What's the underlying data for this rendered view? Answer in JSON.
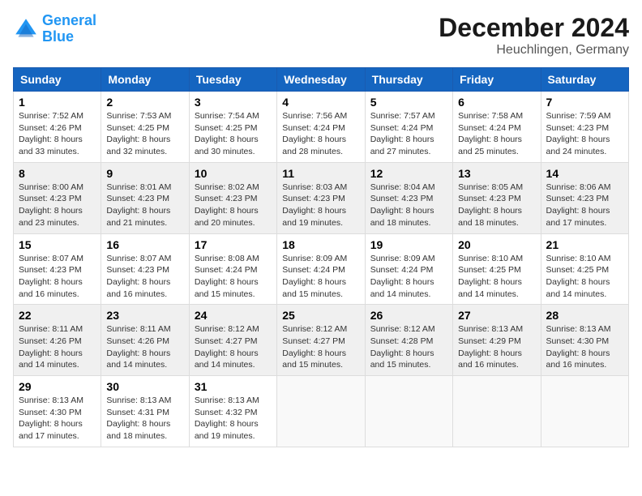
{
  "header": {
    "logo_line1": "General",
    "logo_line2": "Blue",
    "title": "December 2024",
    "subtitle": "Heuchlingen, Germany"
  },
  "calendar": {
    "days_of_week": [
      "Sunday",
      "Monday",
      "Tuesday",
      "Wednesday",
      "Thursday",
      "Friday",
      "Saturday"
    ],
    "weeks": [
      [
        null,
        null,
        null,
        null,
        null,
        null,
        null
      ]
    ],
    "cells": [
      {
        "day": null,
        "info": null
      },
      {
        "day": null,
        "info": null
      },
      {
        "day": null,
        "info": null
      },
      {
        "day": null,
        "info": null
      },
      {
        "day": null,
        "info": null
      },
      {
        "day": null,
        "info": null
      },
      {
        "day": null,
        "info": null
      }
    ],
    "rows": [
      [
        {
          "day": "",
          "info": ""
        },
        {
          "day": "",
          "info": ""
        },
        {
          "day": "",
          "info": ""
        },
        {
          "day": "",
          "info": ""
        },
        {
          "day": "",
          "info": ""
        },
        {
          "day": "",
          "info": ""
        },
        {
          "day": "",
          "info": ""
        }
      ]
    ]
  },
  "days": [
    {
      "num": "1",
      "sunrise": "Sunrise: 7:52 AM",
      "sunset": "Sunset: 4:26 PM",
      "daylight": "Daylight: 8 hours and 33 minutes."
    },
    {
      "num": "2",
      "sunrise": "Sunrise: 7:53 AM",
      "sunset": "Sunset: 4:25 PM",
      "daylight": "Daylight: 8 hours and 32 minutes."
    },
    {
      "num": "3",
      "sunrise": "Sunrise: 7:54 AM",
      "sunset": "Sunset: 4:25 PM",
      "daylight": "Daylight: 8 hours and 30 minutes."
    },
    {
      "num": "4",
      "sunrise": "Sunrise: 7:56 AM",
      "sunset": "Sunset: 4:24 PM",
      "daylight": "Daylight: 8 hours and 28 minutes."
    },
    {
      "num": "5",
      "sunrise": "Sunrise: 7:57 AM",
      "sunset": "Sunset: 4:24 PM",
      "daylight": "Daylight: 8 hours and 27 minutes."
    },
    {
      "num": "6",
      "sunrise": "Sunrise: 7:58 AM",
      "sunset": "Sunset: 4:24 PM",
      "daylight": "Daylight: 8 hours and 25 minutes."
    },
    {
      "num": "7",
      "sunrise": "Sunrise: 7:59 AM",
      "sunset": "Sunset: 4:23 PM",
      "daylight": "Daylight: 8 hours and 24 minutes."
    },
    {
      "num": "8",
      "sunrise": "Sunrise: 8:00 AM",
      "sunset": "Sunset: 4:23 PM",
      "daylight": "Daylight: 8 hours and 23 minutes."
    },
    {
      "num": "9",
      "sunrise": "Sunrise: 8:01 AM",
      "sunset": "Sunset: 4:23 PM",
      "daylight": "Daylight: 8 hours and 21 minutes."
    },
    {
      "num": "10",
      "sunrise": "Sunrise: 8:02 AM",
      "sunset": "Sunset: 4:23 PM",
      "daylight": "Daylight: 8 hours and 20 minutes."
    },
    {
      "num": "11",
      "sunrise": "Sunrise: 8:03 AM",
      "sunset": "Sunset: 4:23 PM",
      "daylight": "Daylight: 8 hours and 19 minutes."
    },
    {
      "num": "12",
      "sunrise": "Sunrise: 8:04 AM",
      "sunset": "Sunset: 4:23 PM",
      "daylight": "Daylight: 8 hours and 18 minutes."
    },
    {
      "num": "13",
      "sunrise": "Sunrise: 8:05 AM",
      "sunset": "Sunset: 4:23 PM",
      "daylight": "Daylight: 8 hours and 18 minutes."
    },
    {
      "num": "14",
      "sunrise": "Sunrise: 8:06 AM",
      "sunset": "Sunset: 4:23 PM",
      "daylight": "Daylight: 8 hours and 17 minutes."
    },
    {
      "num": "15",
      "sunrise": "Sunrise: 8:07 AM",
      "sunset": "Sunset: 4:23 PM",
      "daylight": "Daylight: 8 hours and 16 minutes."
    },
    {
      "num": "16",
      "sunrise": "Sunrise: 8:07 AM",
      "sunset": "Sunset: 4:23 PM",
      "daylight": "Daylight: 8 hours and 16 minutes."
    },
    {
      "num": "17",
      "sunrise": "Sunrise: 8:08 AM",
      "sunset": "Sunset: 4:24 PM",
      "daylight": "Daylight: 8 hours and 15 minutes."
    },
    {
      "num": "18",
      "sunrise": "Sunrise: 8:09 AM",
      "sunset": "Sunset: 4:24 PM",
      "daylight": "Daylight: 8 hours and 15 minutes."
    },
    {
      "num": "19",
      "sunrise": "Sunrise: 8:09 AM",
      "sunset": "Sunset: 4:24 PM",
      "daylight": "Daylight: 8 hours and 14 minutes."
    },
    {
      "num": "20",
      "sunrise": "Sunrise: 8:10 AM",
      "sunset": "Sunset: 4:25 PM",
      "daylight": "Daylight: 8 hours and 14 minutes."
    },
    {
      "num": "21",
      "sunrise": "Sunrise: 8:10 AM",
      "sunset": "Sunset: 4:25 PM",
      "daylight": "Daylight: 8 hours and 14 minutes."
    },
    {
      "num": "22",
      "sunrise": "Sunrise: 8:11 AM",
      "sunset": "Sunset: 4:26 PM",
      "daylight": "Daylight: 8 hours and 14 minutes."
    },
    {
      "num": "23",
      "sunrise": "Sunrise: 8:11 AM",
      "sunset": "Sunset: 4:26 PM",
      "daylight": "Daylight: 8 hours and 14 minutes."
    },
    {
      "num": "24",
      "sunrise": "Sunrise: 8:12 AM",
      "sunset": "Sunset: 4:27 PM",
      "daylight": "Daylight: 8 hours and 14 minutes."
    },
    {
      "num": "25",
      "sunrise": "Sunrise: 8:12 AM",
      "sunset": "Sunset: 4:27 PM",
      "daylight": "Daylight: 8 hours and 15 minutes."
    },
    {
      "num": "26",
      "sunrise": "Sunrise: 8:12 AM",
      "sunset": "Sunset: 4:28 PM",
      "daylight": "Daylight: 8 hours and 15 minutes."
    },
    {
      "num": "27",
      "sunrise": "Sunrise: 8:13 AM",
      "sunset": "Sunset: 4:29 PM",
      "daylight": "Daylight: 8 hours and 16 minutes."
    },
    {
      "num": "28",
      "sunrise": "Sunrise: 8:13 AM",
      "sunset": "Sunset: 4:30 PM",
      "daylight": "Daylight: 8 hours and 16 minutes."
    },
    {
      "num": "29",
      "sunrise": "Sunrise: 8:13 AM",
      "sunset": "Sunset: 4:30 PM",
      "daylight": "Daylight: 8 hours and 17 minutes."
    },
    {
      "num": "30",
      "sunrise": "Sunrise: 8:13 AM",
      "sunset": "Sunset: 4:31 PM",
      "daylight": "Daylight: 8 hours and 18 minutes."
    },
    {
      "num": "31",
      "sunrise": "Sunrise: 8:13 AM",
      "sunset": "Sunset: 4:32 PM",
      "daylight": "Daylight: 8 hours and 19 minutes."
    }
  ]
}
